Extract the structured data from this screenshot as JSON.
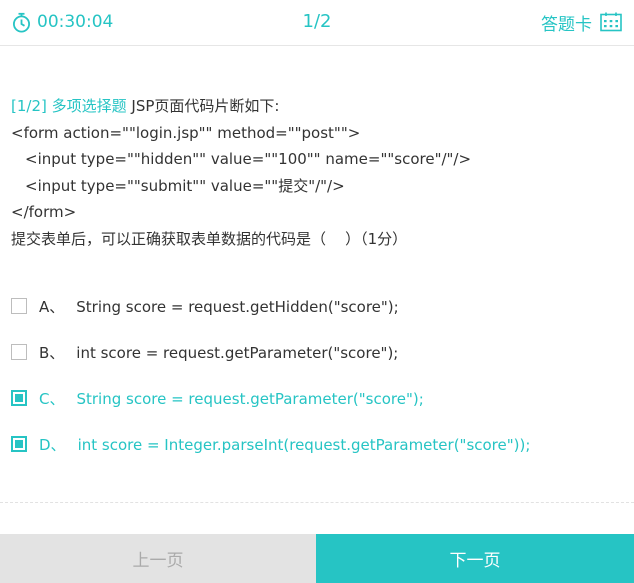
{
  "header": {
    "timer": "00:30:04",
    "progress": "1/2",
    "answer_sheet_label": "答题卡"
  },
  "question": {
    "tag": "[1/2] 多项选择题",
    "prompt": "JSP页面代码片断如下:",
    "code_lines": [
      "<form action=\"\"login.jsp\"\" method=\"\"post\"\">",
      "<input type=\"\"hidden\"\" value=\"\"100\"\" name=\"\"score\"/\"/>",
      "<input type=\"\"submit\"\" value=\"\"提交\"/\"/>",
      "</form>"
    ],
    "ask": "提交表单后，可以正确获取表单数据的代码是（    ）（1分）"
  },
  "options": [
    {
      "letter": "A、",
      "text": "String score = request.getHidden(\"score\");",
      "selected": false
    },
    {
      "letter": "B、",
      "text": "int score = request.getParameter(\"score\");",
      "selected": false
    },
    {
      "letter": "C、",
      "text": "String score = request.getParameter(\"score\");",
      "selected": true
    },
    {
      "letter": "D、",
      "text": "int score = Integer.parseInt(request.getParameter(\"score\"));",
      "selected": true
    }
  ],
  "footer": {
    "prev_label": "上一页",
    "next_label": "下一页"
  },
  "colors": {
    "accent": "#26c4c4",
    "prev_bg": "#e3e3e3",
    "text": "#333333"
  }
}
